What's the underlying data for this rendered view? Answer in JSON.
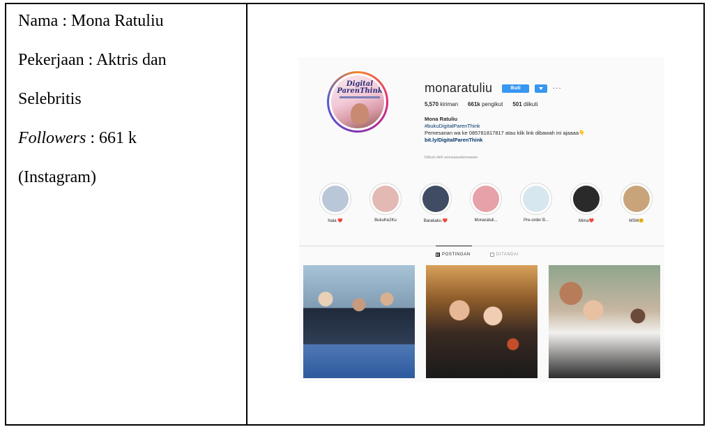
{
  "document": {
    "lines": [
      {
        "label": "Nama",
        "sep": " : ",
        "value": "Mona Ratuliu"
      },
      {
        "label": "Pekerjaan",
        "sep": " : ",
        "value": "Aktris dan"
      },
      {
        "label": "",
        "sep": "",
        "value": "Selebritis"
      },
      {
        "label": "Followers",
        "sep": " :  ",
        "value": "661 k"
      },
      {
        "label": "",
        "sep": "",
        "value": "(Instagram)"
      }
    ]
  },
  "instagram": {
    "username": "monaratuliu",
    "follow_label": "Ikuti",
    "more": "···",
    "stats": {
      "posts_count": "5,570",
      "posts_label": " kiriman",
      "followers_count": "661k",
      "followers_label": " pengikut",
      "following_count": "501",
      "following_label": " diikuti"
    },
    "bio": {
      "name": "Mona Ratuliu",
      "hashtag": "#bukuDigitalParenThink",
      "text": "Pemesanan wa ke 085781817817 atau klik link dibawah ini ajaaaa👇",
      "link": "bit.ly/DigitalParenThink"
    },
    "followed_by": "Diikuti oleh annisasudarmawan",
    "avatar_book_title": "Digital ParenThink",
    "highlights": [
      {
        "label": "Nala ❤️",
        "color": "#b9c7d8"
      },
      {
        "label": "BukuKe2Ku",
        "color": "#e3b9b4"
      },
      {
        "label": "Barakaku ❤️",
        "color": "#3f4c63"
      },
      {
        "label": "Monaratuli...",
        "color": "#e7a1a8"
      },
      {
        "label": "Pre-order B...",
        "color": "#d7e7ef"
      },
      {
        "label": "Mima❤️",
        "color": "#2a2a2a"
      },
      {
        "label": "MSM🤗",
        "color": "#c9a37a"
      }
    ],
    "tabs": [
      {
        "label": "POSTINGAN",
        "active": true
      },
      {
        "label": "DITANDAI",
        "active": false
      }
    ],
    "colors": {
      "accent": "#3897f0",
      "link": "#003569"
    }
  }
}
